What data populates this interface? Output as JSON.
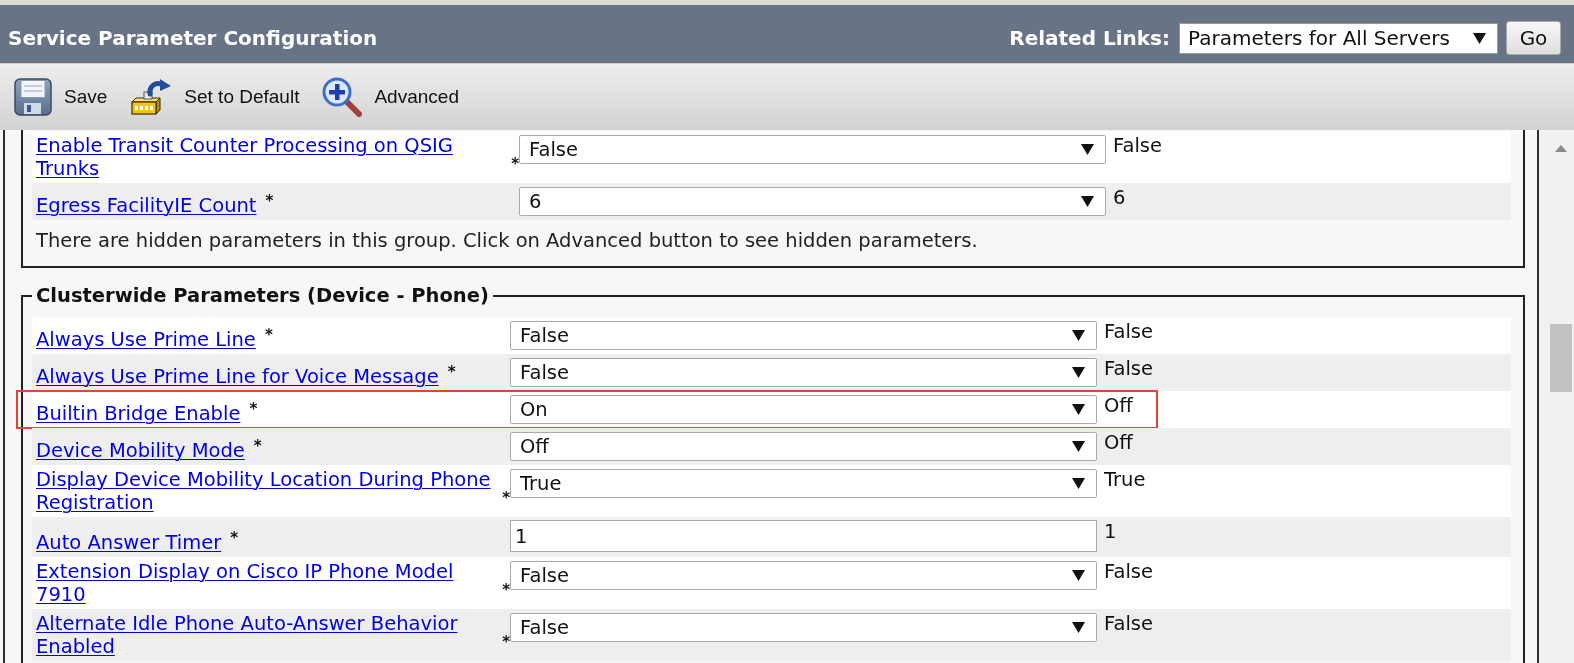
{
  "header": {
    "title": "Service Parameter Configuration",
    "related_links_label": "Related Links:",
    "related_links_value": "Parameters for All Servers",
    "go_button": "Go"
  },
  "toolbar": [
    {
      "kind": "save",
      "label": "Save"
    },
    {
      "kind": "default",
      "label": "Set to Default"
    },
    {
      "kind": "advanced",
      "label": "Advanced"
    }
  ],
  "sections": [
    {
      "rows": [
        {
          "label": "Enable Transit Counter Processing on QSIG Trunks",
          "required_mark": "*",
          "kind": "select",
          "value": "False",
          "default_value": "False",
          "highlighted": false
        },
        {
          "label": "Egress FacilityIE Count",
          "required_mark": "*",
          "kind": "select",
          "value": "6",
          "default_value": "6",
          "highlighted": false
        }
      ],
      "note": "There are hidden parameters in this group. Click on Advanced button to see hidden parameters."
    },
    {
      "legend": "Clusterwide Parameters (Device - Phone)",
      "rows": [
        {
          "label": "Always Use Prime Line",
          "required_mark": "*",
          "kind": "select",
          "value": "False",
          "default_value": "False",
          "highlighted": false
        },
        {
          "label": "Always Use Prime Line for Voice Message",
          "required_mark": "*",
          "kind": "select",
          "value": "False",
          "default_value": "False",
          "highlighted": false
        },
        {
          "label": "Builtin Bridge Enable",
          "required_mark": "*",
          "kind": "select",
          "value": "On",
          "default_value": "Off",
          "highlighted": true
        },
        {
          "label": "Device Mobility Mode",
          "required_mark": "*",
          "kind": "select",
          "value": "Off",
          "default_value": "Off",
          "highlighted": false
        },
        {
          "label": "Display Device Mobility Location During Phone Registration",
          "required_mark": "*",
          "kind": "select",
          "value": "True",
          "default_value": "True",
          "highlighted": false
        },
        {
          "label": "Auto Answer Timer",
          "required_mark": "*",
          "kind": "text",
          "value": "1",
          "default_value": "1",
          "highlighted": false
        },
        {
          "label": "Extension Display on Cisco IP Phone Model 7910",
          "required_mark": "*",
          "kind": "select",
          "value": "False",
          "default_value": "False",
          "highlighted": false
        },
        {
          "label": "Alternate Idle Phone Auto-Answer Behavior Enabled",
          "required_mark": "*",
          "kind": "select",
          "value": "False",
          "default_value": "False",
          "highlighted": false
        }
      ]
    }
  ]
}
